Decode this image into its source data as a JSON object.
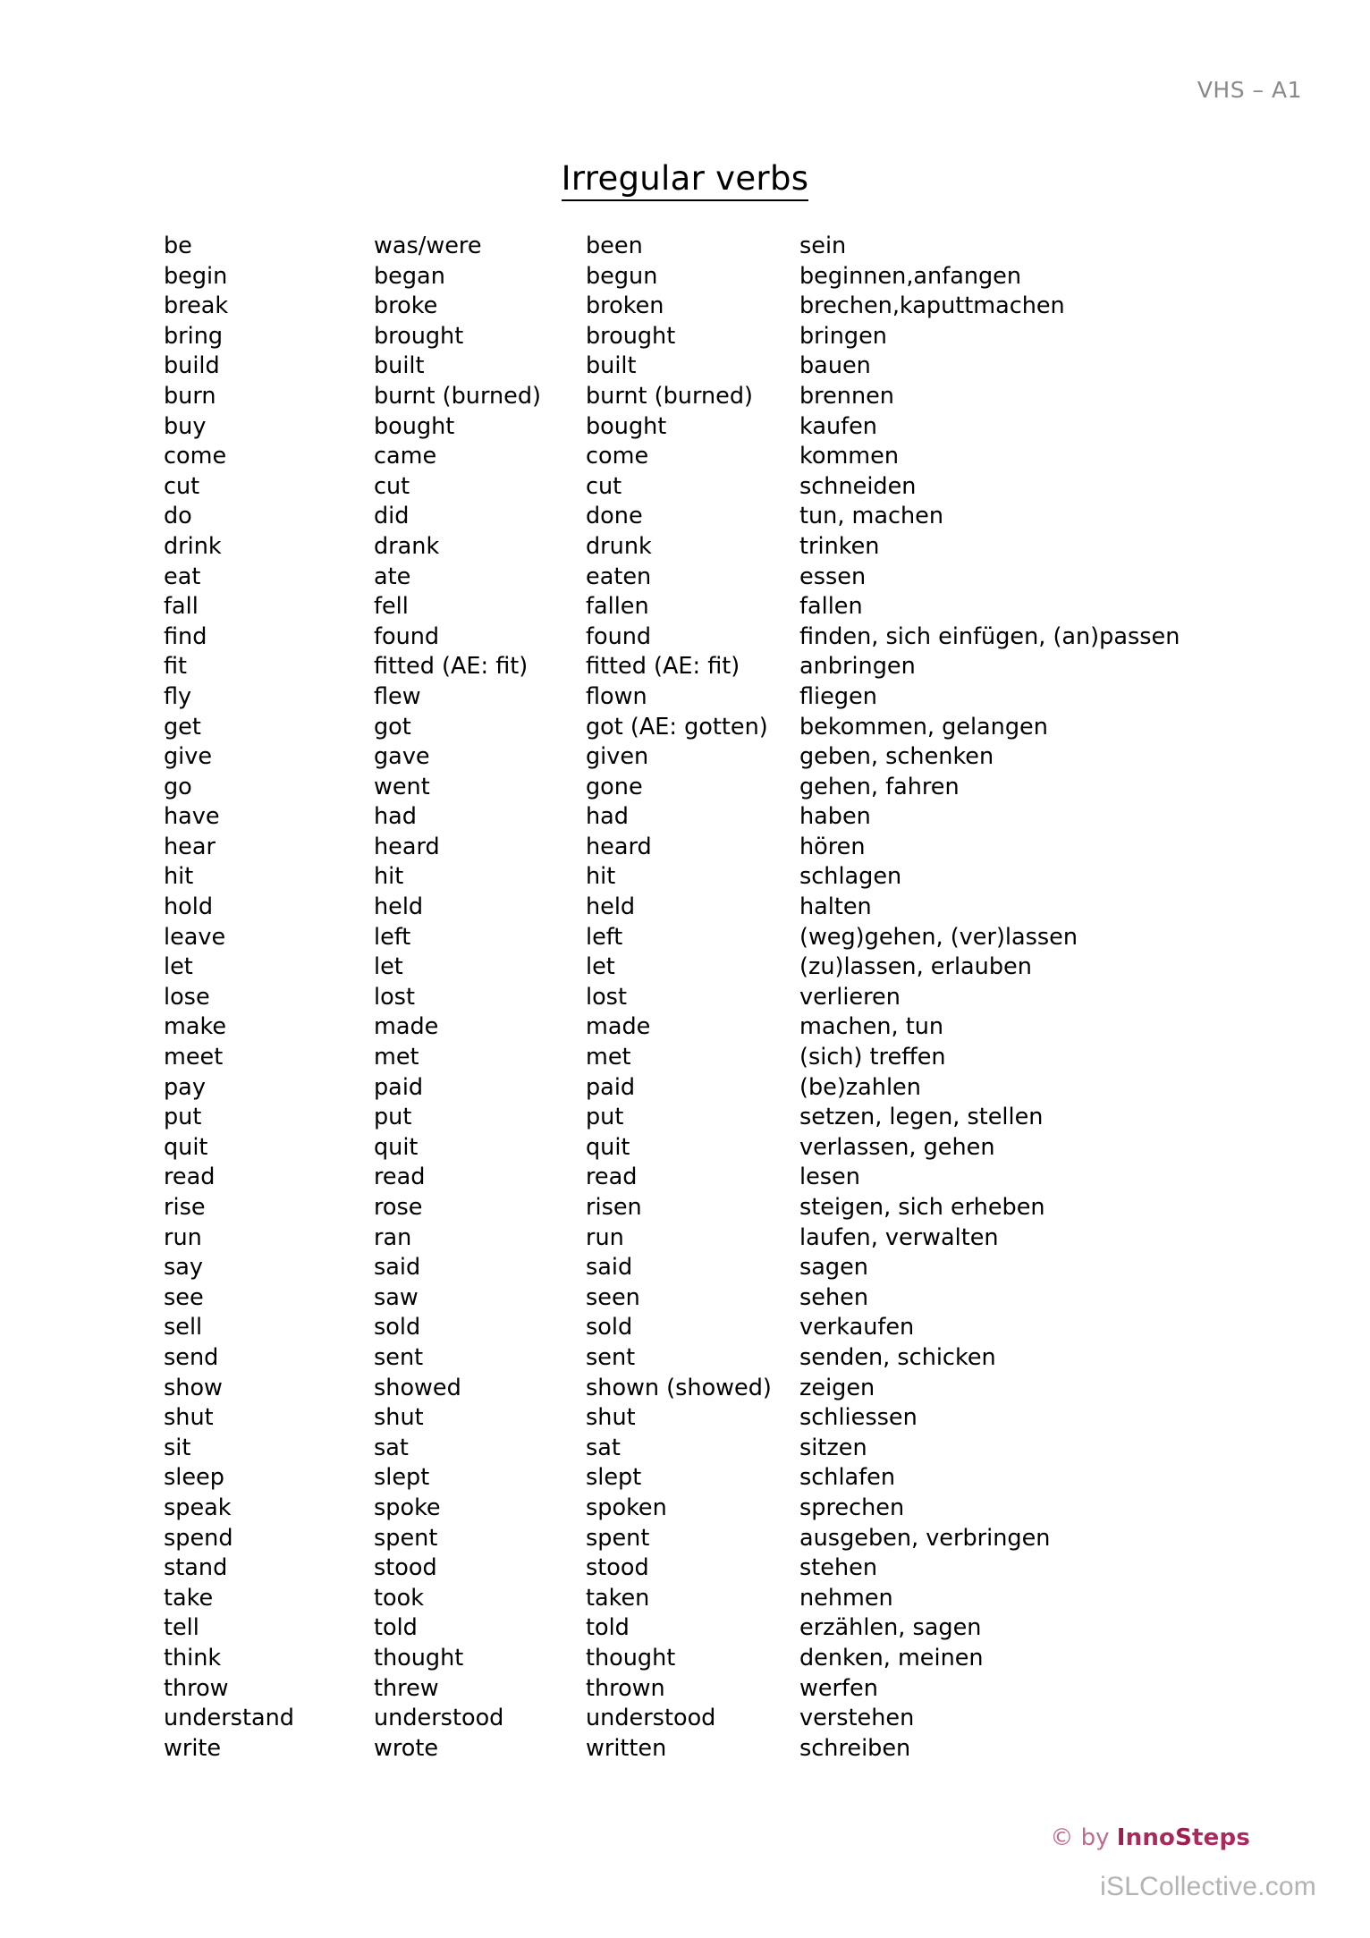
{
  "header": {
    "course_label": "VHS – A1"
  },
  "title": "Irregular verbs",
  "table": {
    "rows": [
      {
        "infinitive": "be",
        "past": "was/were",
        "participle": "been",
        "german": "sein"
      },
      {
        "infinitive": "begin",
        "past": "began",
        "participle": "begun",
        "german": "beginnen,anfangen"
      },
      {
        "infinitive": "break",
        "past": "broke",
        "participle": "broken",
        "german": "brechen,kaputtmachen"
      },
      {
        "infinitive": "bring",
        "past": "brought",
        "participle": "brought",
        "german": "bringen"
      },
      {
        "infinitive": "build",
        "past": "built",
        "participle": "built",
        "german": "bauen"
      },
      {
        "infinitive": "burn",
        "past": "burnt (burned)",
        "participle": "burnt (burned)",
        "german": "brennen"
      },
      {
        "infinitive": "buy",
        "past": "bought",
        "participle": "bought",
        "german": "kaufen"
      },
      {
        "infinitive": "come",
        "past": "came",
        "participle": "come",
        "german": "kommen"
      },
      {
        "infinitive": "cut",
        "past": "cut",
        "participle": "cut",
        "german": "schneiden"
      },
      {
        "infinitive": "do",
        "past": "did",
        "participle": "done",
        "german": "tun, machen"
      },
      {
        "infinitive": "drink",
        "past": "drank",
        "participle": "drunk",
        "german": "trinken"
      },
      {
        "infinitive": "eat",
        "past": "ate",
        "participle": "eaten",
        "german": "essen"
      },
      {
        "infinitive": "fall",
        "past": "fell",
        "participle": "fallen",
        "german": "fallen"
      },
      {
        "infinitive": "find",
        "past": "found",
        "participle": "found",
        "german": "finden, sich einfügen, (an)passen"
      },
      {
        "infinitive": "fit",
        "past": "fitted (AE: fit)",
        "participle": "fitted (AE: fit)",
        "german": "anbringen"
      },
      {
        "infinitive": "fly",
        "past": "flew",
        "participle": "flown",
        "german": "fliegen"
      },
      {
        "infinitive": "get",
        "past": "got",
        "participle": "got (AE: gotten)",
        "german": "bekommen, gelangen"
      },
      {
        "infinitive": "give",
        "past": "gave",
        "participle": "given",
        "german": "geben, schenken"
      },
      {
        "infinitive": "go",
        "past": "went",
        "participle": "gone",
        "german": "gehen, fahren"
      },
      {
        "infinitive": "have",
        "past": "had",
        "participle": "had",
        "german": "haben"
      },
      {
        "infinitive": "hear",
        "past": "heard",
        "participle": "heard",
        "german": "hören"
      },
      {
        "infinitive": "hit",
        "past": "hit",
        "participle": "hit",
        "german": "schlagen"
      },
      {
        "infinitive": "hold",
        "past": "held",
        "participle": "held",
        "german": "halten"
      },
      {
        "infinitive": "leave",
        "past": "left",
        "participle": "left",
        "german": "(weg)gehen, (ver)lassen"
      },
      {
        "infinitive": "let",
        "past": "let",
        "participle": "let",
        "german": "(zu)lassen, erlauben"
      },
      {
        "infinitive": "lose",
        "past": "lost",
        "participle": "lost",
        "german": "verlieren"
      },
      {
        "infinitive": "make",
        "past": "made",
        "participle": "made",
        "german": "machen, tun"
      },
      {
        "infinitive": "meet",
        "past": "met",
        "participle": "met",
        "german": "(sich) treffen"
      },
      {
        "infinitive": "pay",
        "past": "paid",
        "participle": "paid",
        "german": "(be)zahlen"
      },
      {
        "infinitive": "put",
        "past": "put",
        "participle": "put",
        "german": "setzen, legen, stellen"
      },
      {
        "infinitive": "quit",
        "past": "quit",
        "participle": "quit",
        "german": "verlassen, gehen"
      },
      {
        "infinitive": "read",
        "past": "read",
        "participle": "read",
        "german": "lesen"
      },
      {
        "infinitive": "rise",
        "past": "rose",
        "participle": "risen",
        "german": "steigen, sich erheben"
      },
      {
        "infinitive": "run",
        "past": "ran",
        "participle": "run",
        "german": "laufen, verwalten"
      },
      {
        "infinitive": "say",
        "past": "said",
        "participle": "said",
        "german": "sagen"
      },
      {
        "infinitive": "see",
        "past": "saw",
        "participle": "seen",
        "german": "sehen"
      },
      {
        "infinitive": "sell",
        "past": "sold",
        "participle": "sold",
        "german": "verkaufen"
      },
      {
        "infinitive": "send",
        "past": "sent",
        "participle": "sent",
        "german": "senden, schicken"
      },
      {
        "infinitive": "show",
        "past": "showed",
        "participle": "shown (showed)",
        "german": "zeigen"
      },
      {
        "infinitive": "shut",
        "past": "shut",
        "participle": "shut",
        "german": "schliessen"
      },
      {
        "infinitive": "sit",
        "past": "sat",
        "participle": "sat",
        "german": "sitzen"
      },
      {
        "infinitive": "sleep",
        "past": "slept",
        "participle": "slept",
        "german": "schlafen"
      },
      {
        "infinitive": "speak",
        "past": "spoke",
        "participle": "spoken",
        "german": "sprechen"
      },
      {
        "infinitive": "spend",
        "past": "spent",
        "participle": "spent",
        "german": "ausgeben, verbringen"
      },
      {
        "infinitive": "stand",
        "past": "stood",
        "participle": "stood",
        "german": "stehen"
      },
      {
        "infinitive": "take",
        "past": "took",
        "participle": "taken",
        "german": "nehmen"
      },
      {
        "infinitive": "tell",
        "past": "told",
        "participle": "told",
        "german": "erzählen, sagen"
      },
      {
        "infinitive": "think",
        "past": "thought",
        "participle": "thought",
        "german": "denken, meinen"
      },
      {
        "infinitive": "throw",
        "past": "threw",
        "participle": "thrown",
        "german": "werfen"
      },
      {
        "infinitive": "understand",
        "past": "understood",
        "participle": "understood",
        "german": "verstehen"
      },
      {
        "infinitive": "write",
        "past": "wrote",
        "participle": "written",
        "german": "schreiben"
      }
    ]
  },
  "footer": {
    "copyright_prefix": "© by ",
    "brand_parts": [
      "I",
      "nno",
      "S",
      "teps"
    ],
    "brand_full": "InnoSteps",
    "watermark": "iSLCollective.com"
  },
  "colors": {
    "header_gray": "#8a8a8a",
    "brand_pink": "#a82a5e",
    "copyright_pink": "#c06b8e",
    "watermark_gray": "#b3b3b3",
    "text_black": "#000000",
    "page_background": "#ffffff"
  }
}
